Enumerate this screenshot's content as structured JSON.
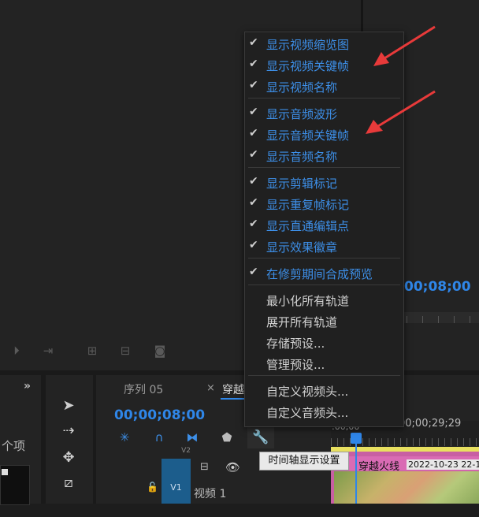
{
  "monitor": {
    "timecode": "00;08;00"
  },
  "left_panel": {
    "chevrons": "»",
    "items_label": "个项"
  },
  "timeline": {
    "tab_sequence": "序列 05",
    "tab_close": "×",
    "tab_active": "穿越",
    "timecode": "00;00;08;00",
    "ruler_start": ":00;00",
    "ruler_timecode": "00;00;29;29",
    "track_v2": "V2",
    "track_v1": "V1",
    "track_name": "视频 1",
    "clip_title": "穿越火线",
    "clip_date": "2022-10-23 22-1"
  },
  "menu": {
    "items": [
      {
        "label": "显示视频缩览图",
        "checked": true
      },
      {
        "label": "显示视频关键帧",
        "checked": true
      },
      {
        "label": "显示视频名称",
        "checked": true
      },
      {
        "label": "显示音频波形",
        "checked": true
      },
      {
        "label": "显示音频关键帧",
        "checked": true
      },
      {
        "label": "显示音频名称",
        "checked": true
      },
      {
        "label": "显示剪辑标记",
        "checked": true
      },
      {
        "label": "显示重复帧标记",
        "checked": true
      },
      {
        "label": "显示直通编辑点",
        "checked": true
      },
      {
        "label": "显示效果徽章",
        "checked": true
      },
      {
        "label": "在修剪期间合成预览",
        "checked": true
      },
      {
        "label": "最小化所有轨道",
        "checked": false
      },
      {
        "label": "展开所有轨道",
        "checked": false
      },
      {
        "label": "存储预设...",
        "checked": false
      },
      {
        "label": "管理预设...",
        "checked": false
      },
      {
        "label": "自定义视频头...",
        "checked": false
      },
      {
        "label": "自定义音频头...",
        "checked": false
      }
    ],
    "check_glyph": "✔"
  },
  "tooltip": "时间轴显示设置",
  "icons": {
    "select_tool": "selection-arrow-icon",
    "track_select": "track-select-forward-icon",
    "ripple": "ripple-edit-icon",
    "razor": "razor-icon",
    "wrench": "wrench-icon"
  },
  "colors": {
    "accent": "#2f86e8",
    "arrow": "#e83a3a",
    "clip": "#c85fa3"
  }
}
